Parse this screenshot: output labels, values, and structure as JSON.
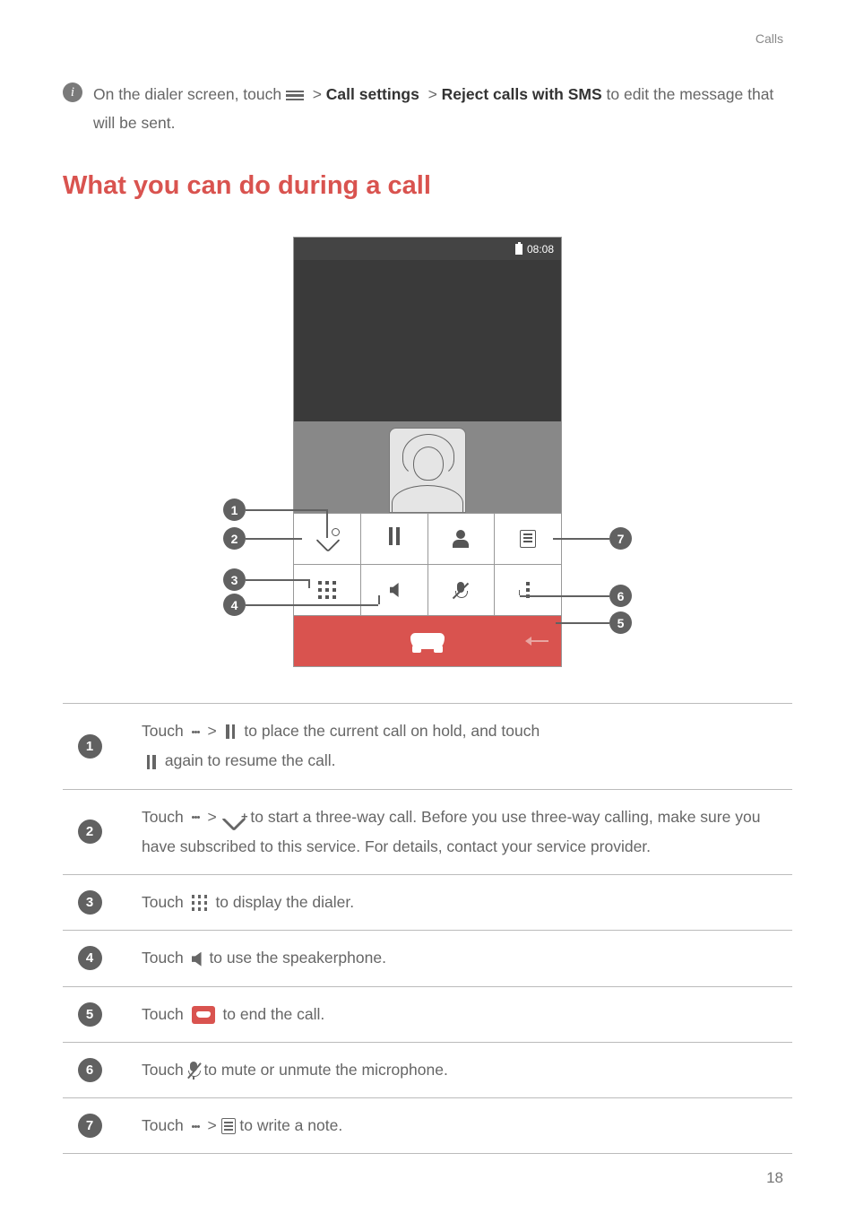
{
  "header": {
    "section": "Calls"
  },
  "tip": {
    "prefix": "On the dialer screen, touch ",
    "path1": "Call settings",
    "path2": "Reject calls with SMS",
    "suffix": " to edit the message that will be sent."
  },
  "title": "What you can do during a call",
  "phone": {
    "time": "08:08"
  },
  "callouts": {
    "b1": "1",
    "b2": "2",
    "b3": "3",
    "b4": "4",
    "b5": "5",
    "b6": "6",
    "b7": "7"
  },
  "rows": {
    "r1": {
      "badge": "1",
      "t1": "Touch ",
      "t2": " > ",
      "t3": " to place the current call on hold, and touch ",
      "t4": " again to resume the call."
    },
    "r2": {
      "badge": "2",
      "t1": "Touch ",
      "t2": " > ",
      "t3": " to start a three-way call. Before you use three-way calling, make sure you have subscribed to this service. For details, contact your service provider."
    },
    "r3": {
      "badge": "3",
      "t1": "Touch ",
      "t2": " to display the dialer."
    },
    "r4": {
      "badge": "4",
      "t1": "Touch ",
      "t2": " to use the speakerphone."
    },
    "r5": {
      "badge": "5",
      "t1": "Touch ",
      "t2": " to end the call."
    },
    "r6": {
      "badge": "6",
      "t1": "Touch ",
      "t2": " to mute or unmute the microphone."
    },
    "r7": {
      "badge": "7",
      "t1": "Touch ",
      "t2": " > ",
      "t3": " to write a note."
    }
  },
  "page": "18"
}
